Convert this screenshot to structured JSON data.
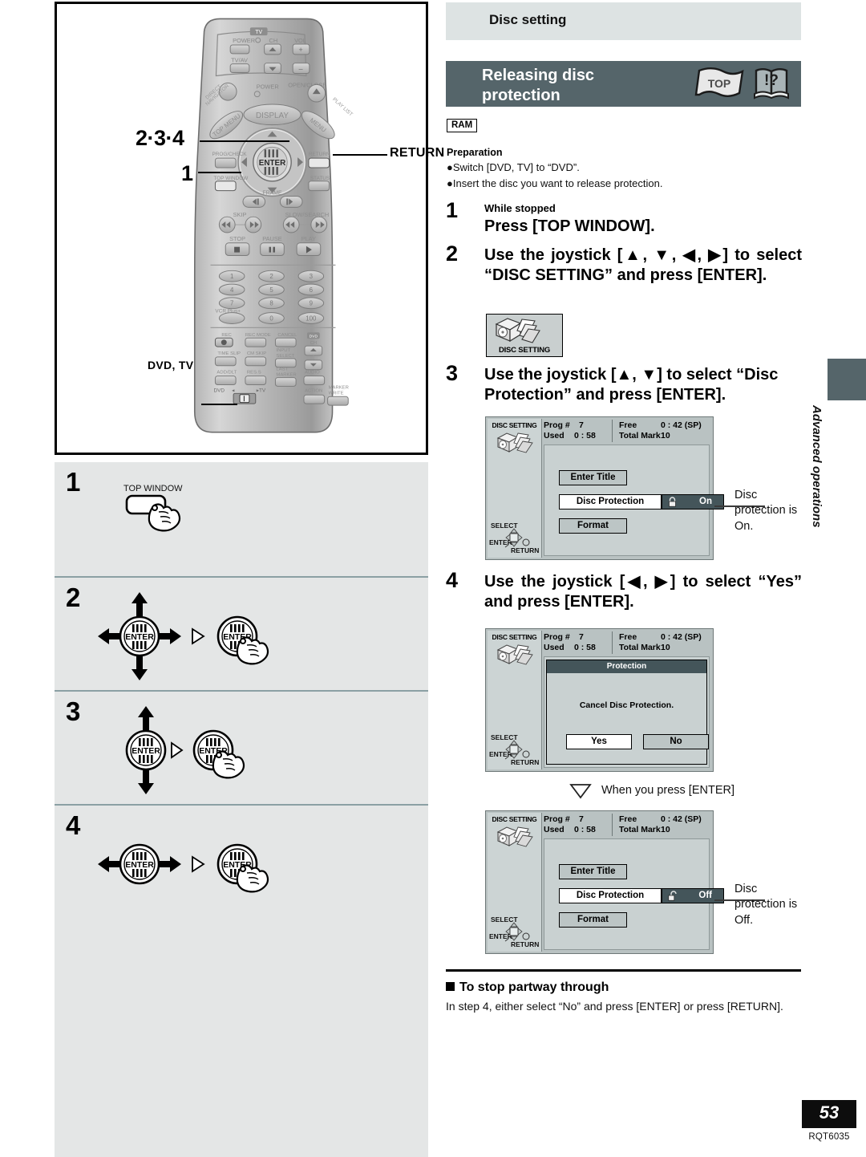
{
  "section": {
    "category_label": "Disc setting",
    "title_line1": "Releasing disc",
    "title_line2": "protection",
    "media_badge": "RAM",
    "icons": {
      "flag": "TOP",
      "book": "!?"
    }
  },
  "preparation": {
    "heading": "Preparation",
    "items": [
      "●Switch [DVD, TV] to “DVD”.",
      "●Insert the disc you want to release protection."
    ]
  },
  "instructions": [
    {
      "number": "1",
      "subtitle": "While stopped",
      "text": "Press [TOP WINDOW]."
    },
    {
      "number": "2",
      "subtitle": "",
      "text": "Use the joystick [▲, ▼, ◀, ▶] to select “DISC SETTING” and press [ENTER].",
      "chip_label": "DISC SETTING"
    },
    {
      "number": "3",
      "subtitle": "",
      "text": "Use the joystick [▲, ▼] to select “Disc Protection” and press [ENTER]."
    },
    {
      "number": "4",
      "subtitle": "",
      "text": "Use the joystick [◀, ▶] to select “Yes” and press [ENTER]."
    }
  ],
  "screens": [
    {
      "id": "screen-protection-on",
      "sidebar_title": "DISC SETTING",
      "nav_labels": {
        "select": "SELECT",
        "enter": "ENTER",
        "return": "RETURN"
      },
      "status": {
        "prog_label": "Prog #",
        "prog_value": "7",
        "free_label": "Free",
        "free_value": "0 : 42 (SP)",
        "used_label": "Used",
        "used_value": "0 : 58",
        "total_mark_label": "Total Mark",
        "total_mark_value": "10"
      },
      "buttons": {
        "enter_title": "Enter Title",
        "format": "Format"
      },
      "protection_row": {
        "name": "Disc Protection",
        "value": "On"
      },
      "annotation": "Disc\nprotection is\nOn."
    },
    {
      "id": "screen-protection-dialog",
      "sidebar_title": "DISC SETTING",
      "nav_labels": {
        "select": "SELECT",
        "enter": "ENTER",
        "return": "RETURN"
      },
      "status": {
        "prog_label": "Prog #",
        "prog_value": "7",
        "free_label": "Free",
        "free_value": "0 : 42 (SP)",
        "used_label": "Used",
        "used_value": "0 : 58",
        "total_mark_label": "Total Mark",
        "total_mark_value": "10"
      },
      "dialog": {
        "title": "Protection",
        "message": "Cancel Disc Protection.",
        "yes": "Yes",
        "no": "No"
      },
      "transition_note": "When you press [ENTER]"
    },
    {
      "id": "screen-protection-off",
      "sidebar_title": "DISC SETTING",
      "nav_labels": {
        "select": "SELECT",
        "enter": "ENTER",
        "return": "RETURN"
      },
      "status": {
        "prog_label": "Prog #",
        "prog_value": "7",
        "free_label": "Free",
        "free_value": "0 : 42 (SP)",
        "used_label": "Used",
        "used_value": "0 : 58",
        "total_mark_label": "Total Mark",
        "total_mark_value": "10"
      },
      "buttons": {
        "enter_title": "Enter Title",
        "format": "Format"
      },
      "protection_row": {
        "name": "Disc Protection",
        "value": "Off"
      },
      "annotation": "Disc\nprotection is\nOff."
    }
  ],
  "stop_partway": {
    "heading": "To stop partway through",
    "body": "In step 4, either select “No” and press [ENTER] or press [RETURN]."
  },
  "remote": {
    "callouts": {
      "joystick": "2·3·4",
      "top_window": "1",
      "return": "RETURN",
      "dvd_tv": "DVD, TV"
    },
    "labels": {
      "tv": "TV",
      "power": "POWER",
      "ch": "CH",
      "vol": "VOL",
      "tv_av": "TV/AV",
      "power2": "POWER",
      "open_close": "OPEN/CLOSE",
      "display": "DISPLAY",
      "direct_navigator": "DIRECT NAVIGATOR",
      "top_menu": "TOP MENU",
      "play_list": "PLAY LIST",
      "menu": "MENU",
      "enter": "ENTER",
      "prog_check": "PROG/CHECK",
      "return": "RETURN",
      "top_window": "TOP WINDOW",
      "status": "STATUS",
      "frame": "FRAME",
      "skip": "SKIP",
      "slow_search": "SLOW/SEARCH",
      "stop": "STOP",
      "pause": "PAUSE",
      "play": "PLAY",
      "vcr_plus": "VCR Plus+",
      "rec": "REC",
      "rec_mode": "REC MODE",
      "cancel": "CANCEL",
      "dvd_ch": "DVD CH",
      "time_slip": "TIME SLIP",
      "cm_skip": "CM SKIP",
      "input_select": "INPUT SELECT",
      "add_dlt": "ADD/DLT",
      "res_s": "RES.S",
      "last_marker": "LAST MARKER",
      "audio": "AUDIO",
      "dvd": "DVD",
      "tv_sw": "TV",
      "action": "ACTION",
      "marker_write": "MARKER WRITE"
    },
    "keypad": [
      "1",
      "2",
      "3",
      "4",
      "5",
      "6",
      "7",
      "8",
      "9",
      "0",
      "100"
    ]
  },
  "step_figures": [
    {
      "number": "1",
      "button_label": "TOP WINDOW",
      "kind": "press-button"
    },
    {
      "number": "2",
      "button_label": "ENTER",
      "kind": "joystick-4way-then-enter"
    },
    {
      "number": "3",
      "button_label": "ENTER",
      "kind": "joystick-updown-then-enter"
    },
    {
      "number": "4",
      "button_label": "ENTER",
      "kind": "joystick-leftright-then-enter"
    }
  ],
  "side_tab": {
    "label": "Advanced operations"
  },
  "footer": {
    "page_number": "53",
    "doc_code": "RQT6035"
  },
  "colors": {
    "header_bar": "#55656a",
    "category_bar": "#dde3e3",
    "step_bg": "#e4e6e6",
    "screen_bg": "#b9c2c2",
    "screen_body": "#c9d1d1",
    "dark_field": "#44555a"
  }
}
